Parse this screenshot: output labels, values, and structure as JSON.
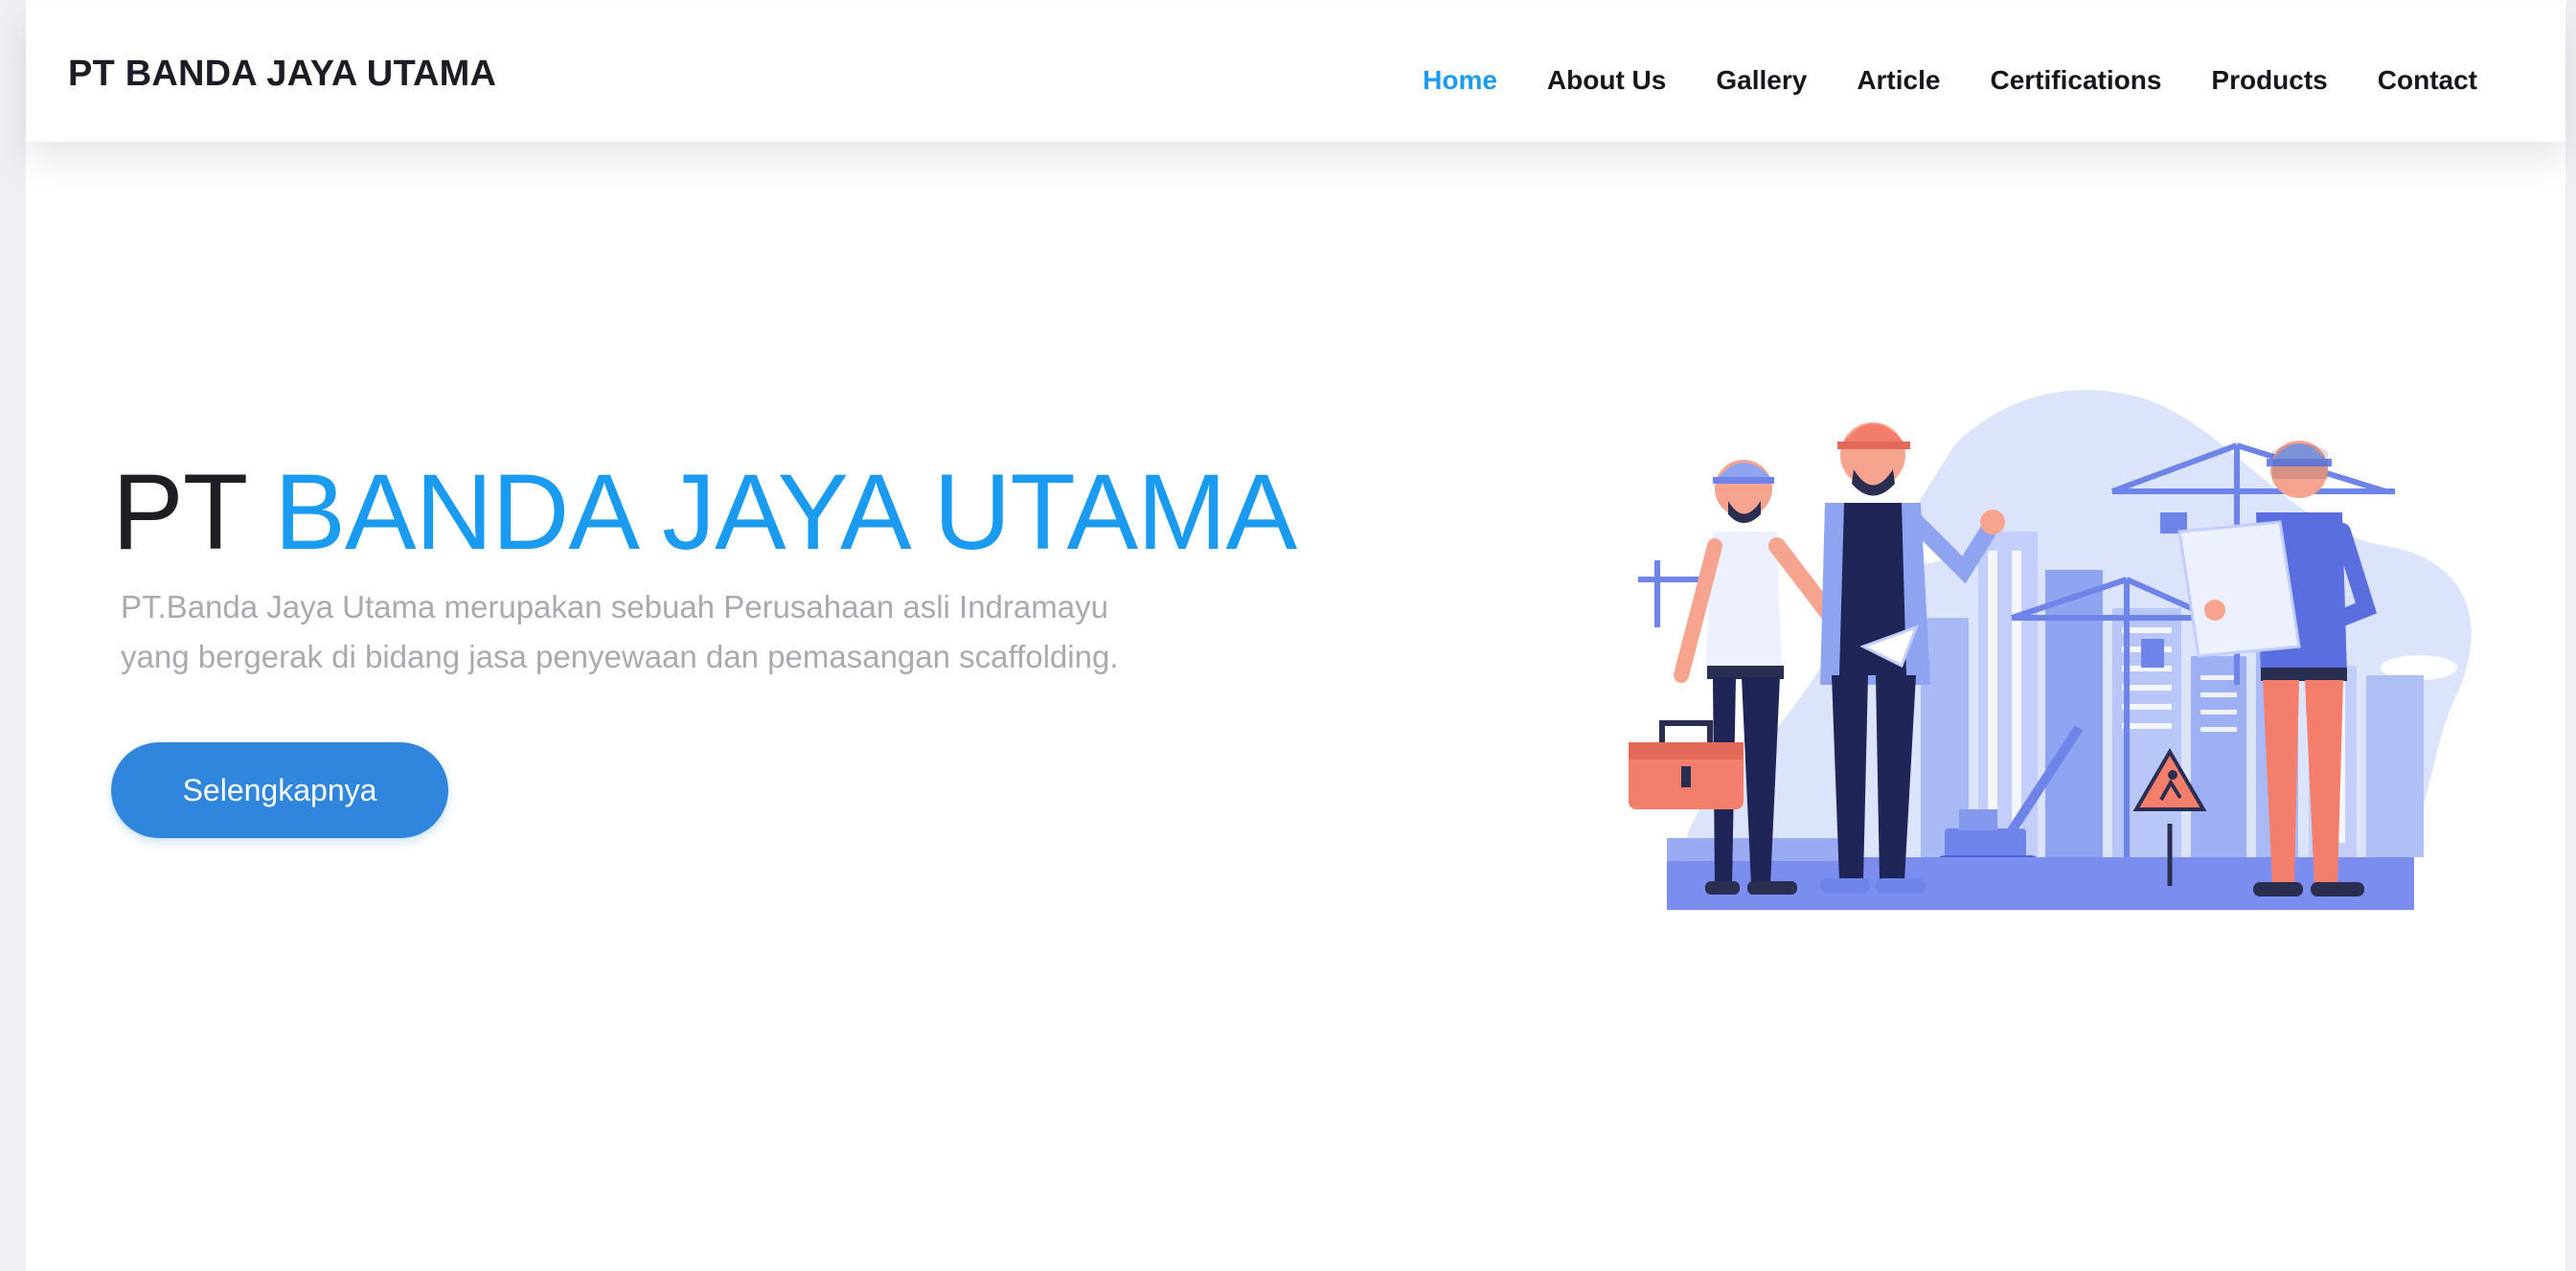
{
  "header": {
    "brand": "PT BANDA JAYA UTAMA",
    "nav": [
      {
        "label": "Home",
        "active": true
      },
      {
        "label": "About Us"
      },
      {
        "label": "Gallery"
      },
      {
        "label": "Article"
      },
      {
        "label": "Certifications"
      },
      {
        "label": "Products"
      },
      {
        "label": "Contact"
      }
    ]
  },
  "hero": {
    "title_prefix": "PT",
    "title_accent": "BANDA JAYA UTAMA",
    "description_line1": "PT.Banda Jaya Utama merupakan sebuah Perusahaan asli Indramayu",
    "description_line2": "yang bergerak di bidang jasa penyewaan dan pemasangan scaffolding.",
    "cta_label": "Selengkapnya"
  },
  "colors": {
    "accent": "#1a9bf0",
    "button": "#2f86dc",
    "text_dark": "#1e1e24",
    "text_muted": "#a9a9b1"
  },
  "illustration": {
    "icon": "construction-workers-illustration"
  }
}
